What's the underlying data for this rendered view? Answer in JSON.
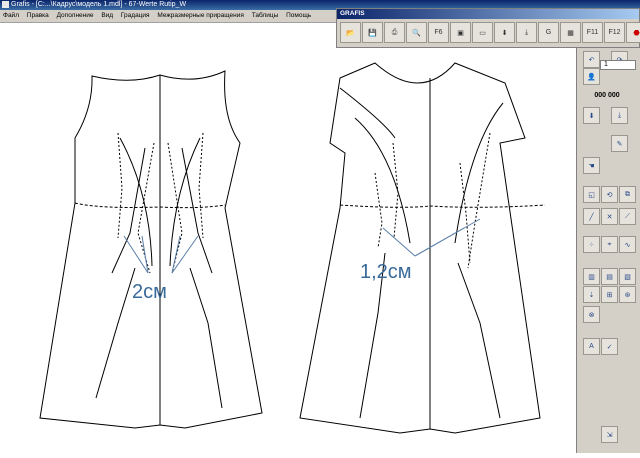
{
  "window": {
    "title": "Grafis - [C:...\\Кадрус\\модель 1.mdl] - 67-Werte Rutip_W"
  },
  "menu": {
    "items": [
      "Файл",
      "Правка",
      "Дополнение",
      "Вид",
      "Градация",
      "Межразмерные приращения",
      "Таблицы",
      "Помощь"
    ]
  },
  "toolbar": {
    "title": "GRAFIS",
    "buttons": [
      {
        "icon": "open-folder-icon"
      },
      {
        "icon": "save-icon"
      },
      {
        "icon": "print-icon"
      },
      {
        "icon": "zoom-icon"
      },
      {
        "icon": "f6-icon",
        "label": "F6"
      },
      {
        "icon": "window-icon"
      },
      {
        "icon": "ruler-icon"
      },
      {
        "icon": "arrow-down-icon"
      },
      {
        "icon": "arrow-down-stack-icon"
      },
      {
        "icon": "g-icon",
        "label": "G"
      },
      {
        "icon": "ruler-grid-icon"
      },
      {
        "icon": "f11-icon",
        "label": "F11"
      },
      {
        "icon": "f12-icon",
        "label": "F12"
      },
      {
        "icon": "stop-icon"
      }
    ]
  },
  "side_panel": {
    "field_value": "1",
    "counter": "000 000",
    "colors": {
      "panel": "#d4d0c8",
      "accent": "#2a4a8a"
    }
  },
  "drawing": {
    "left_label": "2см",
    "right_label": "1,2см",
    "label_color": "#3a6a9a"
  }
}
